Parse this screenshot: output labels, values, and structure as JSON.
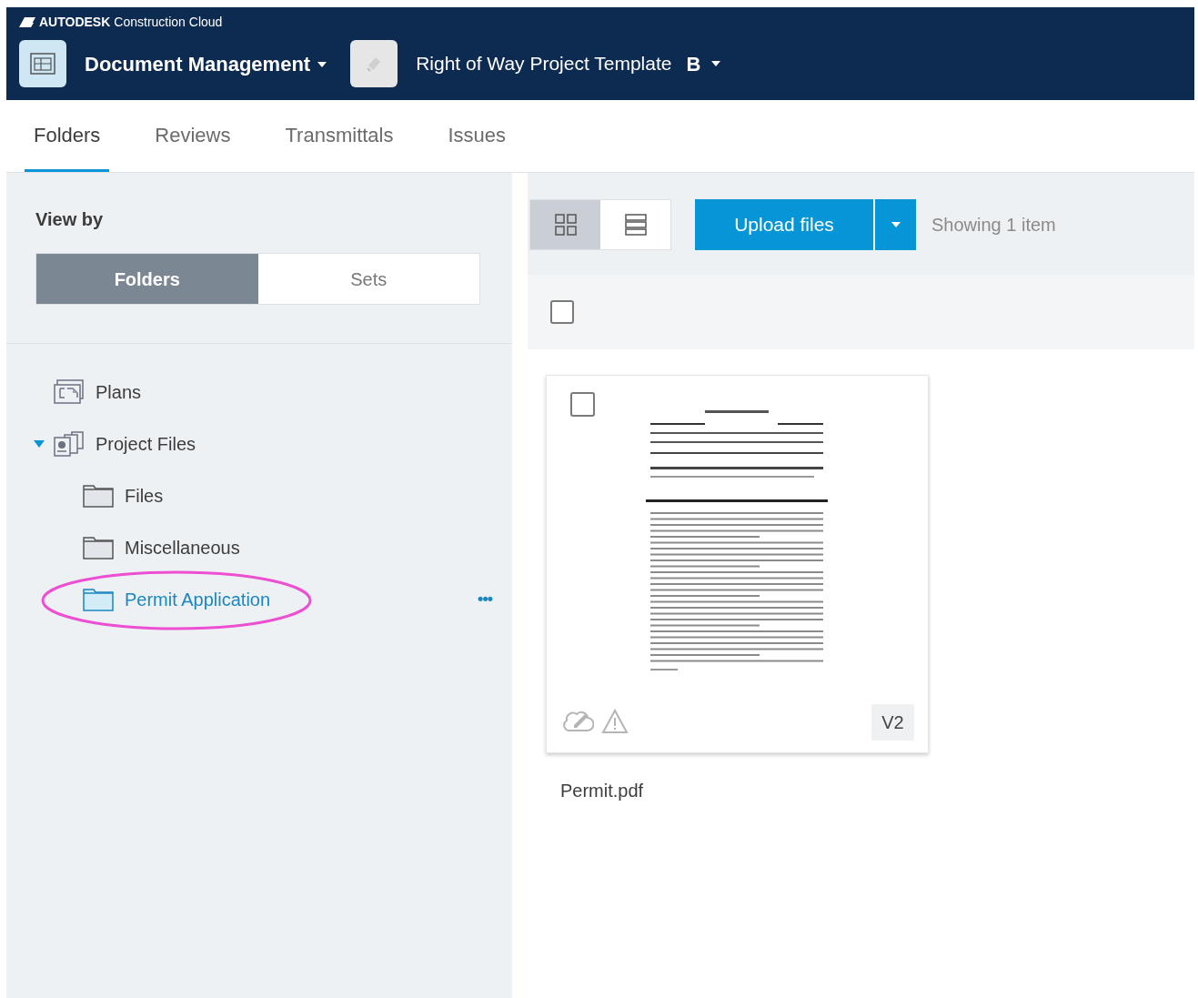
{
  "header": {
    "brand": "AUTODESK",
    "product": "Construction Cloud",
    "module": "Document Management",
    "project": "Right of Way Project Template",
    "project_badge": "B"
  },
  "tabs": [
    {
      "label": "Folders",
      "selected": true
    },
    {
      "label": "Reviews",
      "selected": false
    },
    {
      "label": "Transmittals",
      "selected": false
    },
    {
      "label": "Issues",
      "selected": false
    }
  ],
  "sidebar": {
    "view_by_label": "View by",
    "view_options": [
      {
        "label": "Folders",
        "selected": true
      },
      {
        "label": "Sets",
        "selected": false
      }
    ],
    "tree": [
      {
        "label": "Plans",
        "kind": "plans",
        "selected": false
      },
      {
        "label": "Project Files",
        "kind": "files",
        "selected": false,
        "expanded": true,
        "children": [
          {
            "label": "Files",
            "kind": "folder",
            "selected": false
          },
          {
            "label": "Miscellaneous",
            "kind": "folder",
            "selected": false
          },
          {
            "label": "Permit Application",
            "kind": "folder",
            "selected": true,
            "circled": true,
            "more": "•••"
          }
        ]
      }
    ]
  },
  "toolbar": {
    "views": [
      {
        "kind": "grid",
        "selected": true
      },
      {
        "kind": "list",
        "selected": false
      }
    ],
    "upload": "Upload files",
    "count": "Showing 1 item"
  },
  "select_all": {
    "checked": false
  },
  "files": [
    {
      "name": "Permit.pdf",
      "version": "V2",
      "checked": false,
      "kind": "picture"
    }
  ]
}
